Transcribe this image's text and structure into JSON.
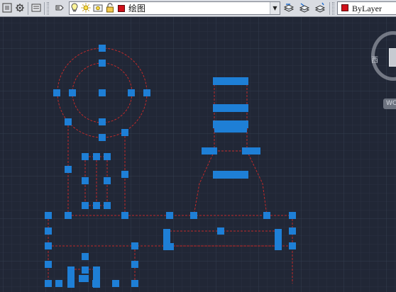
{
  "toolbar": {
    "icons": [
      "layer-grip",
      "layer-states-icon",
      "layer-properties-icon",
      "layer-isolate-icon",
      "lightbulb-icon",
      "sun-icon",
      "freeze-icon",
      "lock-icon"
    ],
    "layer_combo": {
      "value": "绘图",
      "color": "#d0101a"
    },
    "right_icons": [
      "layer-previous-icon",
      "make-current-icon",
      "match-layer-icon"
    ],
    "color_combo": {
      "value": "ByLayer",
      "color": "#d0101a"
    }
  },
  "viewcube": {
    "compass_west": "西",
    "wcs_label": "WC"
  },
  "canvas": {
    "background": "#212736",
    "grip_color": "#1e7fd6",
    "geometry_color": "#c02a2a"
  }
}
